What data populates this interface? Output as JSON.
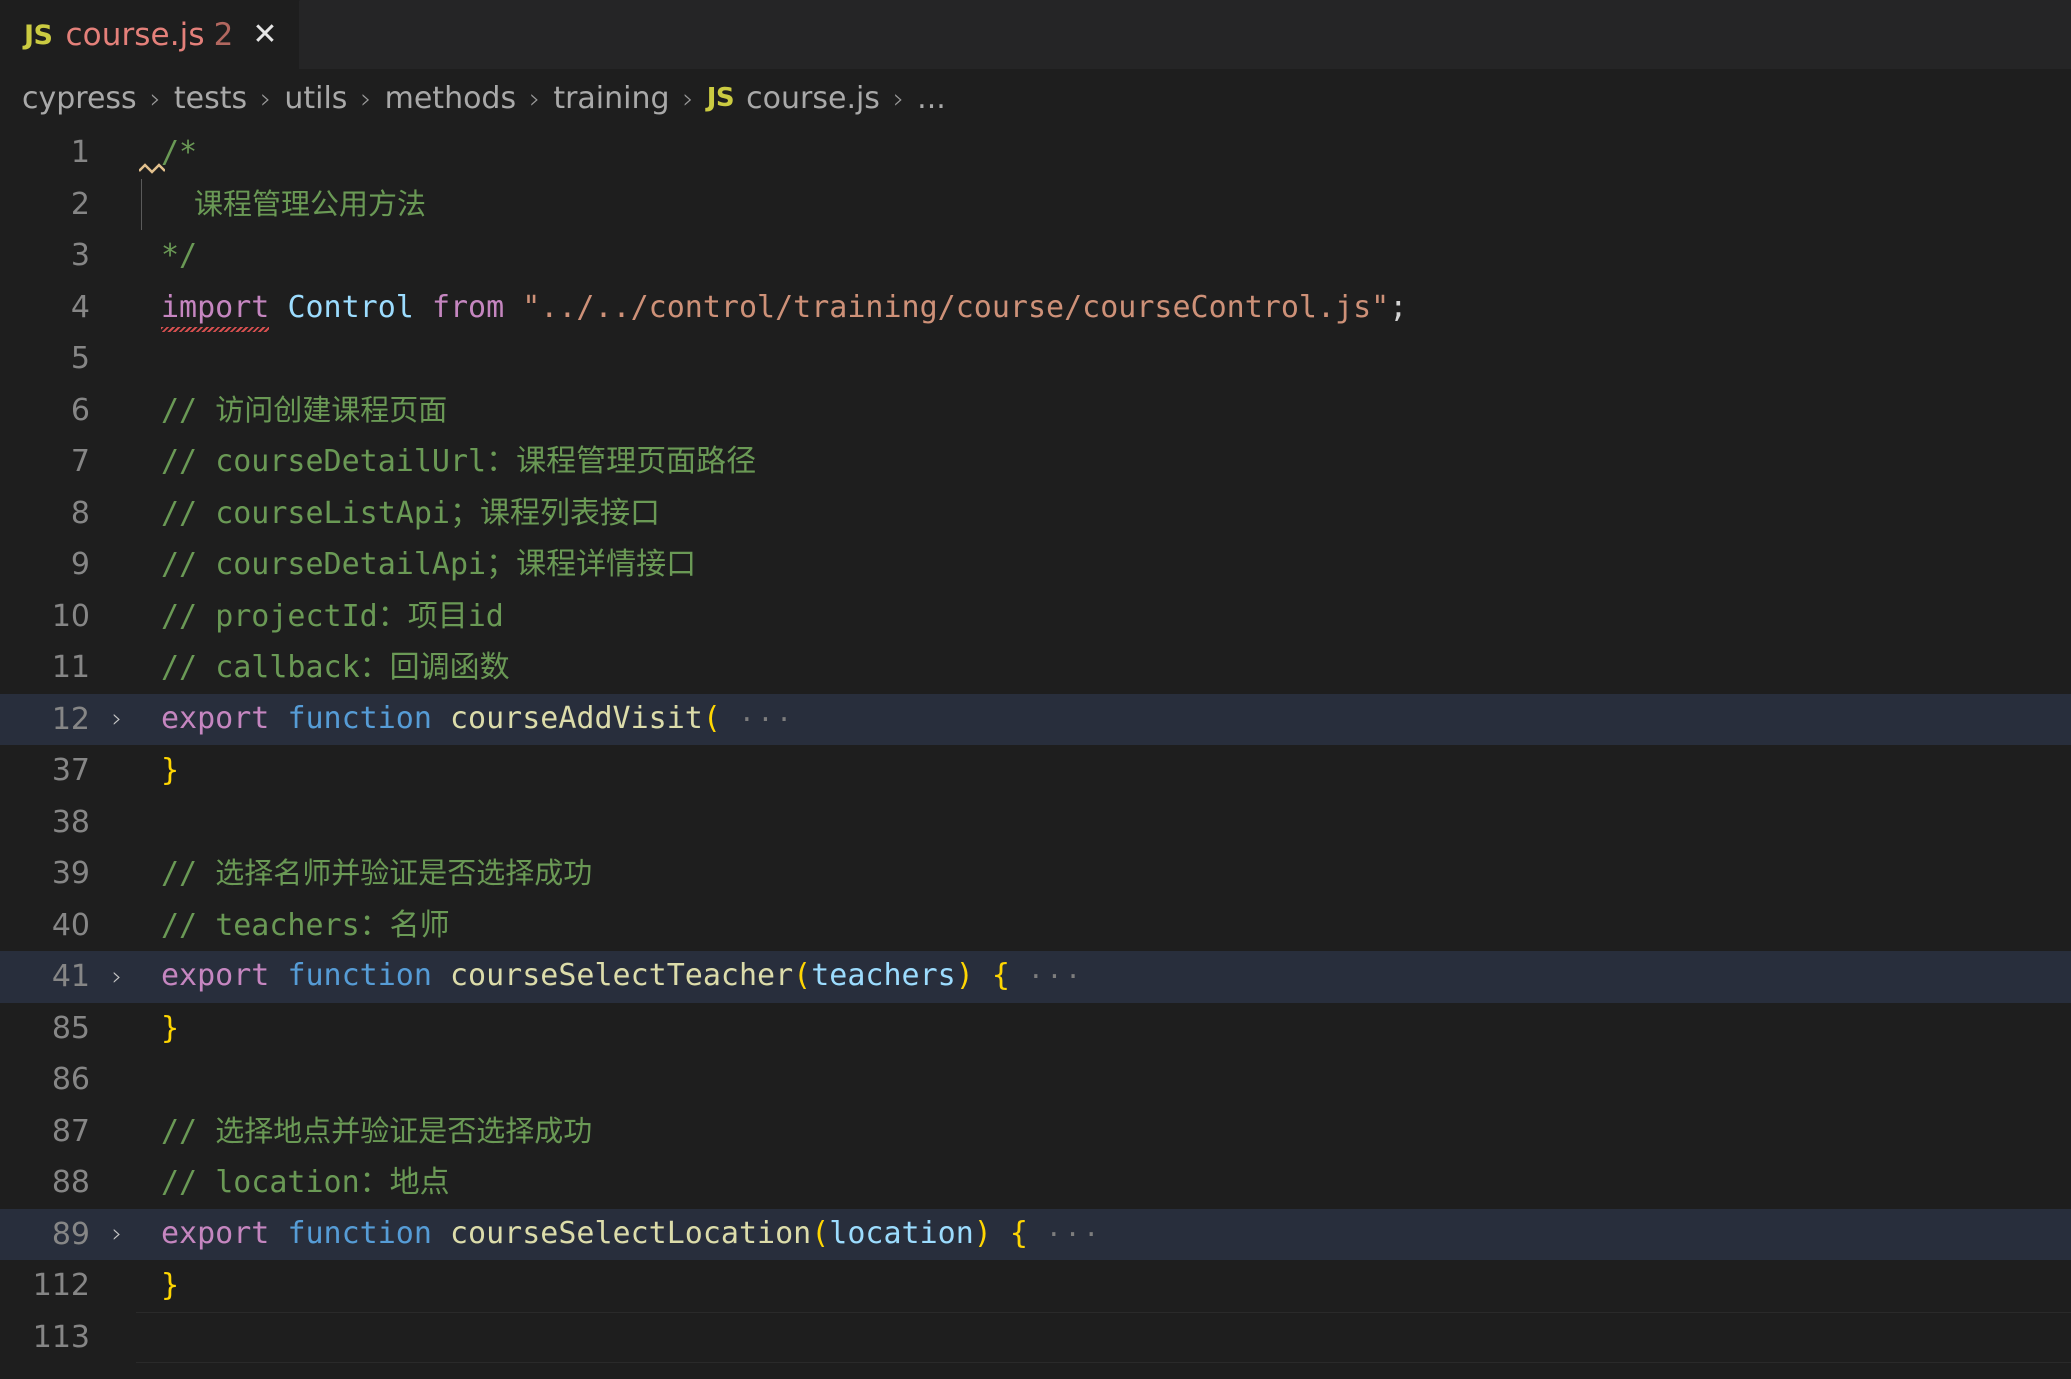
{
  "tab": {
    "icon": "JS",
    "filename": "course.js",
    "badge": "2",
    "close": "✕"
  },
  "breadcrumb": {
    "separator": "›",
    "items": [
      "cypress",
      "tests",
      "utils",
      "methods",
      "training"
    ],
    "file_icon": "JS",
    "file": "course.js",
    "overflow": "..."
  },
  "colors": {
    "editor_background": "#1e1e1e",
    "tabbar_background": "#252526",
    "highlight_line": "#282e3c",
    "comment_green": "#6a9955",
    "keyword_purple": "#c586c0",
    "control_blue": "#569cd6",
    "variable_blue": "#9cdcfe",
    "string_orange": "#ce9178",
    "function_yellow": "#dcdcaa",
    "brace_gold": "#ffd602",
    "line_number": "#868686",
    "tab_label_red": "#e4807a",
    "js_icon_yellow": "#cbcb41"
  },
  "editor": {
    "fold_chevron": "›",
    "fold_ellipsis": "···",
    "lines": [
      {
        "num": "1",
        "text": "/*"
      },
      {
        "num": "2",
        "text": "课程管理公用方法"
      },
      {
        "num": "3",
        "text": "*/"
      },
      {
        "num": "4",
        "text": "import Control from \"../../control/training/course/courseControl.js\";"
      },
      {
        "num": "5",
        "text": ""
      },
      {
        "num": "6",
        "text": "// 访问创建课程页面"
      },
      {
        "num": "7",
        "text": "// courseDetailUrl：课程管理页面路径"
      },
      {
        "num": "8",
        "text": "// courseListApi；课程列表接口"
      },
      {
        "num": "9",
        "text": "// courseDetailApi；课程详情接口"
      },
      {
        "num": "10",
        "text": "// projectId：项目id"
      },
      {
        "num": "11",
        "text": "// callback：回调函数"
      },
      {
        "num": "12",
        "text": "export function courseAddVisit("
      },
      {
        "num": "37",
        "text": "}"
      },
      {
        "num": "38",
        "text": ""
      },
      {
        "num": "39",
        "text": "// 选择名师并验证是否选择成功"
      },
      {
        "num": "40",
        "text": "// teachers：名师"
      },
      {
        "num": "41",
        "text": "export function courseSelectTeacher(teachers) {"
      },
      {
        "num": "85",
        "text": "}"
      },
      {
        "num": "86",
        "text": ""
      },
      {
        "num": "87",
        "text": "// 选择地点并验证是否选择成功"
      },
      {
        "num": "88",
        "text": "// location：地点"
      },
      {
        "num": "89",
        "text": "export function courseSelectLocation(location) {"
      },
      {
        "num": "112",
        "text": "}"
      },
      {
        "num": "113",
        "text": ""
      }
    ],
    "tokens": {
      "comment_slashes": "//",
      "import_kw": "import",
      "control_ident": "Control",
      "from_kw": "from",
      "import_path": "\"../../control/training/course/courseControl.js\"",
      "semicolon": ";",
      "block_open": "/*",
      "block_close": "*/",
      "doc_text": "课程管理公用方法",
      "export_kw": "export",
      "function_kw": "function",
      "fn_courseAddVisit": "courseAddVisit",
      "fn_courseSelectTeacher": "courseSelectTeacher",
      "fn_courseSelectLocation": "courseSelectLocation",
      "param_teachers": "teachers",
      "param_location": "location",
      "paren_open": "(",
      "paren_close": ")",
      "brace_open": "{",
      "brace_close": "}",
      "c6": "访问创建课程页面",
      "c7": "courseDetailUrl：课程管理页面路径",
      "c8": "courseListApi；课程列表接口",
      "c9": "courseDetailApi；课程详情接口",
      "c10": "projectId：项目id",
      "c11": "callback：回调函数",
      "c39": "选择名师并验证是否选择成功",
      "c40": "teachers：名师",
      "c87": "选择地点并验证是否选择成功",
      "c88": "location：地点"
    }
  }
}
